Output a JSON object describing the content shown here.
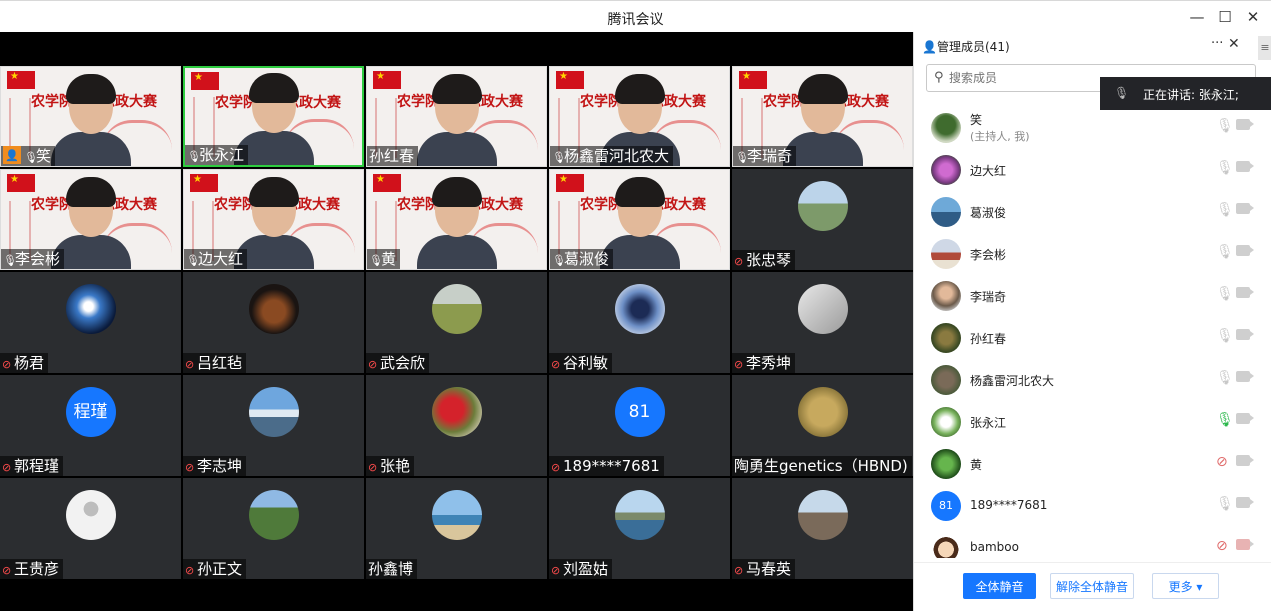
{
  "window": {
    "title": "腾讯会议"
  },
  "tiles": [
    {
      "name": "笑",
      "mic": "on",
      "host": true,
      "kind": "slide"
    },
    {
      "name": "张永江",
      "mic": "on",
      "kind": "slide",
      "active": true
    },
    {
      "name": "孙红春",
      "mic": "none",
      "kind": "slide"
    },
    {
      "name": "杨鑫雷河北农大",
      "mic": "on",
      "kind": "slide"
    },
    {
      "name": "李瑞奇",
      "mic": "on",
      "kind": "slide"
    },
    {
      "name": "李会彬",
      "mic": "on",
      "kind": "slide"
    },
    {
      "name": "边大红",
      "mic": "on",
      "kind": "slide"
    },
    {
      "name": "黄",
      "mic": "on",
      "kind": "slide"
    },
    {
      "name": "葛淑俊",
      "mic": "on",
      "kind": "slide"
    },
    {
      "name": "张忠琴",
      "mic": "muted",
      "kind": "avatar",
      "avatar": "landscape"
    },
    {
      "name": "杨君",
      "mic": "muted",
      "kind": "avatar",
      "avatar": "earth"
    },
    {
      "name": "吕红毡",
      "mic": "muted",
      "kind": "avatar",
      "avatar": "cello"
    },
    {
      "name": "武会欣",
      "mic": "muted",
      "kind": "avatar",
      "avatar": "field"
    },
    {
      "name": "谷利敏",
      "mic": "muted",
      "kind": "avatar",
      "avatar": "abstract"
    },
    {
      "name": "李秀坤",
      "mic": "muted",
      "kind": "avatar",
      "avatar": "sketch"
    },
    {
      "name": "郭程瑾",
      "mic": "muted",
      "kind": "text",
      "avatar_text": "程瑾"
    },
    {
      "name": "李志坤",
      "mic": "muted",
      "kind": "avatar",
      "avatar": "lake"
    },
    {
      "name": "张艳",
      "mic": "muted",
      "kind": "avatar",
      "avatar": "flower"
    },
    {
      "name": "189****7681",
      "mic": "muted",
      "kind": "text",
      "avatar_text": "81"
    },
    {
      "name": "陶勇生genetics（HBND)",
      "mic": "none",
      "kind": "avatar",
      "avatar": "beans"
    },
    {
      "name": "王贵彦",
      "mic": "muted",
      "kind": "avatar",
      "avatar": "default"
    },
    {
      "name": "孙正文",
      "mic": "muted",
      "kind": "avatar",
      "avatar": "crops"
    },
    {
      "name": "孙鑫博",
      "mic": "none",
      "kind": "avatar",
      "avatar": "seaside"
    },
    {
      "name": "刘盈姑",
      "mic": "muted",
      "kind": "avatar",
      "avatar": "bay"
    },
    {
      "name": "马春英",
      "mic": "muted",
      "kind": "avatar",
      "avatar": "rocks"
    }
  ],
  "slide_title": "农学院课程思政大赛",
  "host_badge": "👤",
  "panel": {
    "title": "管理成员(41)",
    "more": "···",
    "close": "✕",
    "search_placeholder": "搜索成员",
    "speaking": "正在讲话: 张永江;",
    "members": [
      {
        "name": "笑",
        "sub": "(主持人, 我)",
        "mic": "idle",
        "cam": "idle",
        "avatar": "tree"
      },
      {
        "name": "边大红",
        "mic": "idle",
        "cam": "idle",
        "avatar": "pinkflower"
      },
      {
        "name": "葛淑俊",
        "mic": "idle",
        "cam": "idle",
        "avatar": "water"
      },
      {
        "name": "李会彬",
        "mic": "idle",
        "cam": "idle",
        "avatar": "palace"
      },
      {
        "name": "李瑞奇",
        "mic": "idle",
        "cam": "idle",
        "avatar": "man"
      },
      {
        "name": "孙红春",
        "mic": "idle",
        "cam": "idle",
        "avatar": "plant"
      },
      {
        "name": "杨鑫雷河北农大",
        "mic": "idle",
        "cam": "idle",
        "avatar": "group"
      },
      {
        "name": "张永江",
        "mic": "on",
        "cam": "idle",
        "avatar": "whiteflower"
      },
      {
        "name": "黄",
        "mic": "off",
        "cam": "idle",
        "avatar": "leaf"
      },
      {
        "name": "189****7681",
        "mic": "idle",
        "cam": "idle",
        "avatar_text": "81"
      },
      {
        "name": "bamboo",
        "mic": "off",
        "cam": "off",
        "avatar": "cartoon"
      }
    ],
    "buttons": {
      "mute_all": "全体静音",
      "unmute_all": "解除全体静音",
      "more": "更多 ▾"
    }
  },
  "colors": {
    "accent": "#1677ff",
    "slide_red": "#c21515",
    "active_border": "#2ecc40"
  }
}
